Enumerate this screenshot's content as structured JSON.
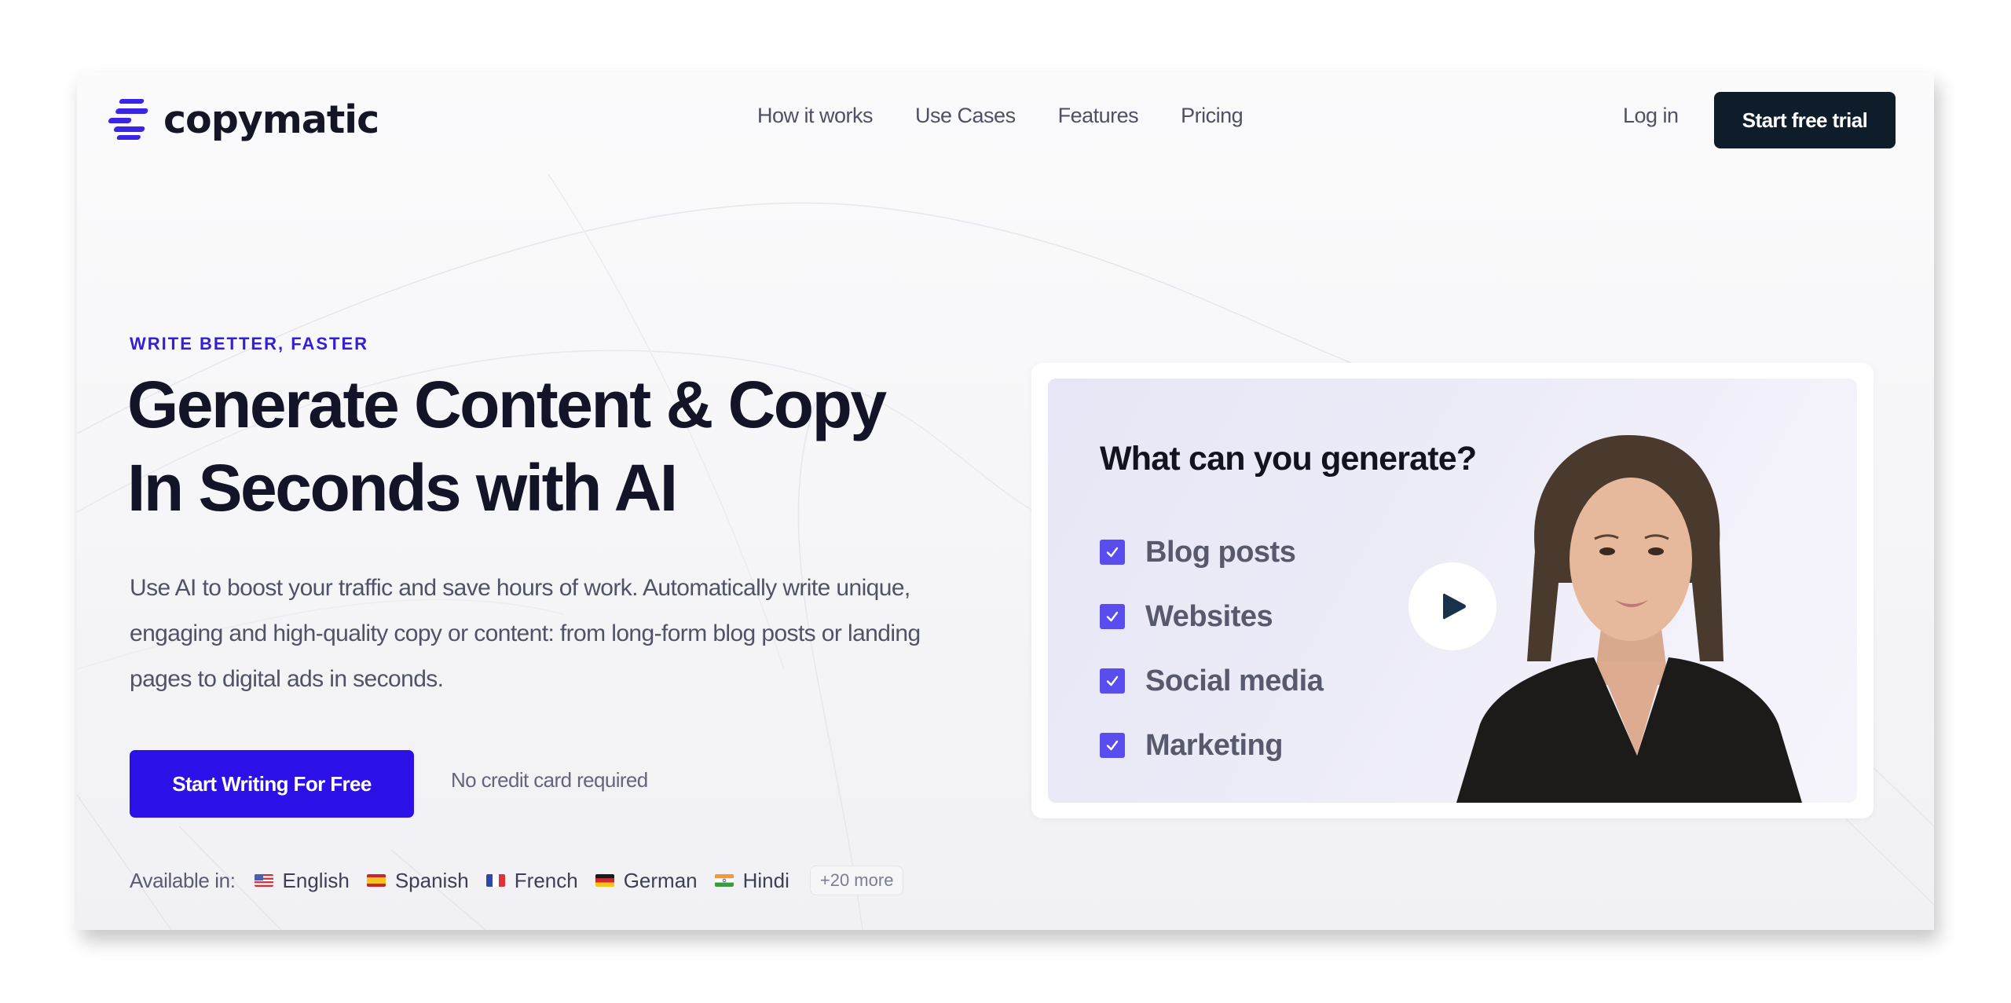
{
  "brand": {
    "name": "copymatic",
    "accent_color": "#2c10e8",
    "dark_color": "#0f1d2b"
  },
  "nav": {
    "links": [
      "How it works",
      "Use Cases",
      "Features",
      "Pricing"
    ],
    "login_label": "Log in",
    "trial_label": "Start free trial"
  },
  "hero": {
    "eyebrow": "WRITE BETTER, FASTER",
    "headline_line1": "Generate Content & Copy",
    "headline_line2": "In Seconds with AI",
    "subtitle": "Use AI to boost your traffic and save hours of work. Automatically write unique, engaging and high-quality copy or content: from long-form blog posts or landing pages to digital ads in seconds.",
    "cta_label": "Start Writing For Free",
    "cta_note": "No credit card required"
  },
  "languages": {
    "label": "Available in:",
    "items": [
      {
        "name": "English",
        "flag": "us-flag-icon"
      },
      {
        "name": "Spanish",
        "flag": "es-flag-icon"
      },
      {
        "name": "French",
        "flag": "fr-flag-icon"
      },
      {
        "name": "German",
        "flag": "de-flag-icon"
      },
      {
        "name": "Hindi",
        "flag": "in-flag-icon"
      }
    ],
    "more_label": "+20 more"
  },
  "video": {
    "title": "What can you generate?",
    "items": [
      "Blog posts",
      "Websites",
      "Social media",
      "Marketing"
    ],
    "play_icon": "play-icon"
  }
}
